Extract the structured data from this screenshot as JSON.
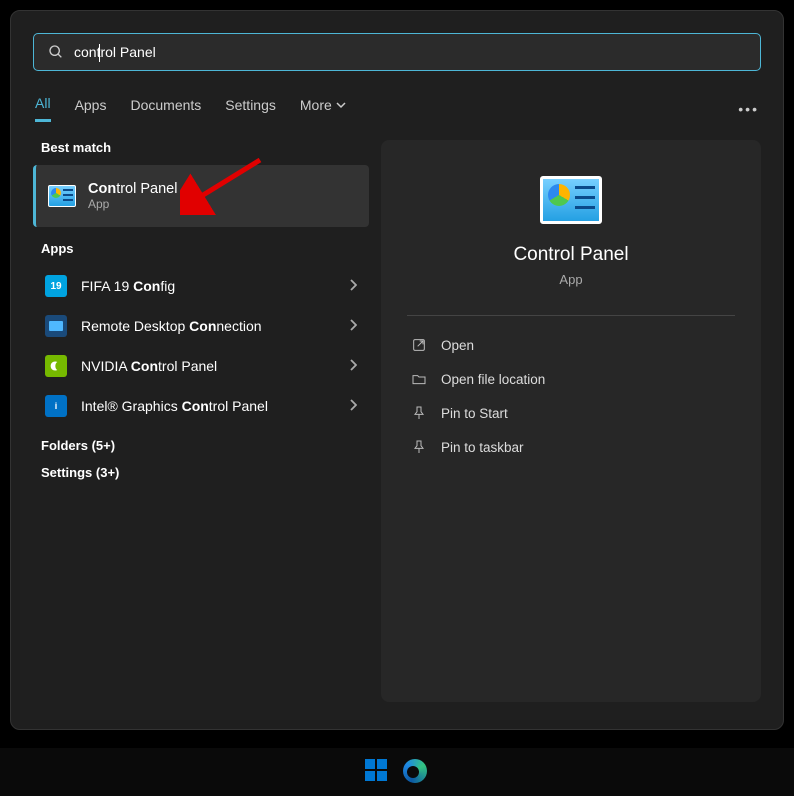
{
  "search": {
    "query": "control Panel"
  },
  "tabs": {
    "all": "All",
    "apps": "Apps",
    "documents": "Documents",
    "settings": "Settings",
    "more": "More"
  },
  "sections": {
    "best_match": "Best match",
    "apps": "Apps"
  },
  "best_match": {
    "title_pre": "Con",
    "title_post": "trol Panel",
    "subtitle": "App"
  },
  "apps_list": [
    {
      "pre": "FIFA 19 ",
      "bold": "Con",
      "post": "fig",
      "icon": "fifa",
      "icon_text": "19"
    },
    {
      "pre": "Remote Desktop ",
      "bold": "Con",
      "post": "nection",
      "icon": "rdp",
      "icon_text": ""
    },
    {
      "pre": "NVIDIA ",
      "bold": "Con",
      "post": "trol Panel",
      "icon": "nvidia",
      "icon_text": ""
    },
    {
      "pre": "Intel® Graphics ",
      "bold": "Con",
      "post": "trol Panel",
      "icon": "intel",
      "icon_text": "i"
    }
  ],
  "collapsed": {
    "folders": "Folders (5+)",
    "settings": "Settings (3+)"
  },
  "preview": {
    "title": "Control Panel",
    "subtitle": "App"
  },
  "actions": {
    "open": "Open",
    "open_location": "Open file location",
    "pin_start": "Pin to Start",
    "pin_taskbar": "Pin to taskbar"
  }
}
